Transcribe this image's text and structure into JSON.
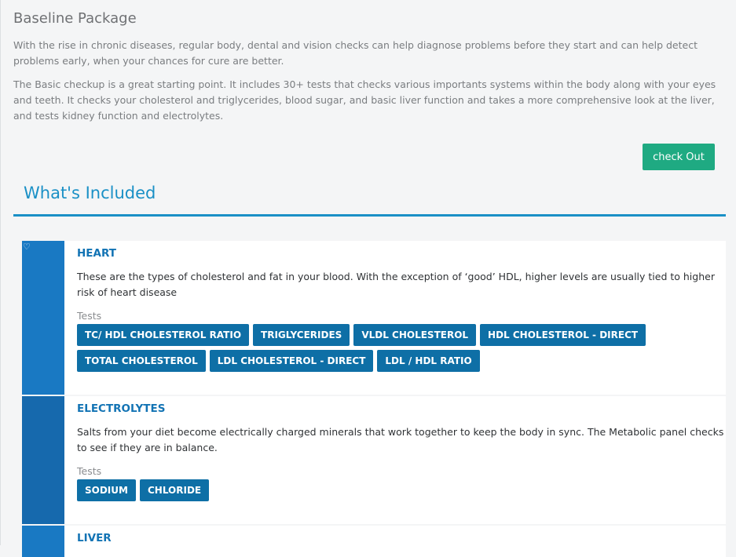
{
  "package": {
    "title": "Baseline Package",
    "paragraph1": "With the rise in chronic diseases, regular body, dental and vision checks can help diagnose problems before they start and can help detect problems early, when your chances for cure are better.",
    "paragraph2": "The Basic checkup is a great starting point. It includes 30+ tests that checks various importants systems within the body along with your eyes and teeth. It checks your cholesterol and triglycerides, blood sugar, and basic liver function and takes a more comprehensive look at the liver, and tests kidney function and electrolytes.",
    "checkout_label": "check Out"
  },
  "included": {
    "title": "What's Included",
    "categories": [
      {
        "name": "HEART",
        "description": "These are the types of cholesterol and fat in your blood. With the exception of ‘good’ HDL, higher levels are usually tied to higher risk of heart disease",
        "tests_label": "Tests",
        "tests": [
          "TC/ HDL CHOLESTEROL RATIO",
          "TRIGLYCERIDES",
          "VLDL CHOLESTEROL",
          "HDL CHOLESTEROL - DIRECT",
          "TOTAL CHOLESTEROL",
          "LDL CHOLESTEROL - DIRECT",
          "LDL / HDL RATIO"
        ]
      },
      {
        "name": "ELECTROLYTES",
        "description": "Salts from your diet become electrically charged minerals that work together to keep the body in sync. The Metabolic panel checks to see if they are in balance.",
        "tests_label": "Tests",
        "tests": [
          "SODIUM",
          "CHLORIDE"
        ]
      },
      {
        "name": "LIVER"
      }
    ]
  },
  "icons": {
    "heart": "heart-outline-icon"
  },
  "colors": {
    "accent": "#1a90c6",
    "checkout": "#1faa82",
    "tag": "#0e6fa6",
    "category_bar": "#1979c3"
  }
}
